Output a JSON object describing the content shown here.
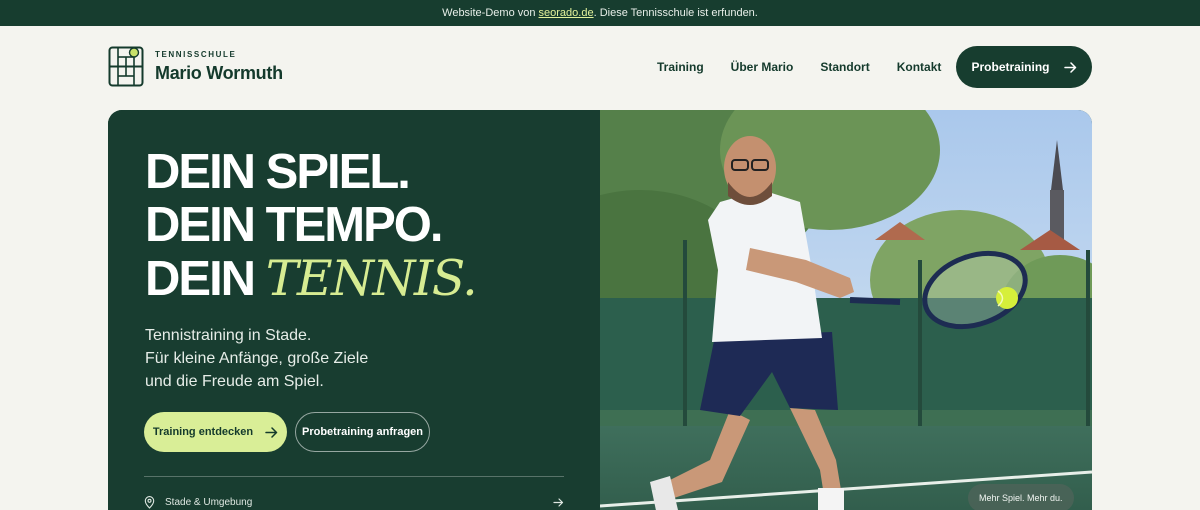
{
  "topbar": {
    "prefix": "Website-Demo von ",
    "link": "seorado.de",
    "suffix": ". Diese Tennisschule ist erfunden."
  },
  "logo": {
    "kicker": "TENNISSCHULE",
    "name": "Mario Wormuth"
  },
  "nav": {
    "items": [
      "Training",
      "Über Mario",
      "Standort",
      "Kontakt"
    ]
  },
  "header_cta": {
    "label": "Probetraining",
    "icon": "arrow-right-icon"
  },
  "hero": {
    "headline": {
      "line1": "DEIN SPIEL.",
      "line2": "DEIN TEMPO.",
      "line3_prefix": "DEIN ",
      "line3_accent": "TENNIS."
    },
    "subtext": {
      "line1": "Tennistraining in Stade.",
      "line2": "Für kleine Anfänge, große Ziele",
      "line3": "und die Freude am Spiel."
    },
    "primary_button": "Training entdecken",
    "secondary_button": "Probetraining anfragen",
    "location": {
      "label": "Stade & Umgebung",
      "icon": "map-pin-icon"
    },
    "photo_badge": "Mehr Spiel. Mehr du."
  },
  "colors": {
    "brand_dark": "#173d2f",
    "accent": "#d9ee97",
    "background": "#f4f4ef"
  }
}
